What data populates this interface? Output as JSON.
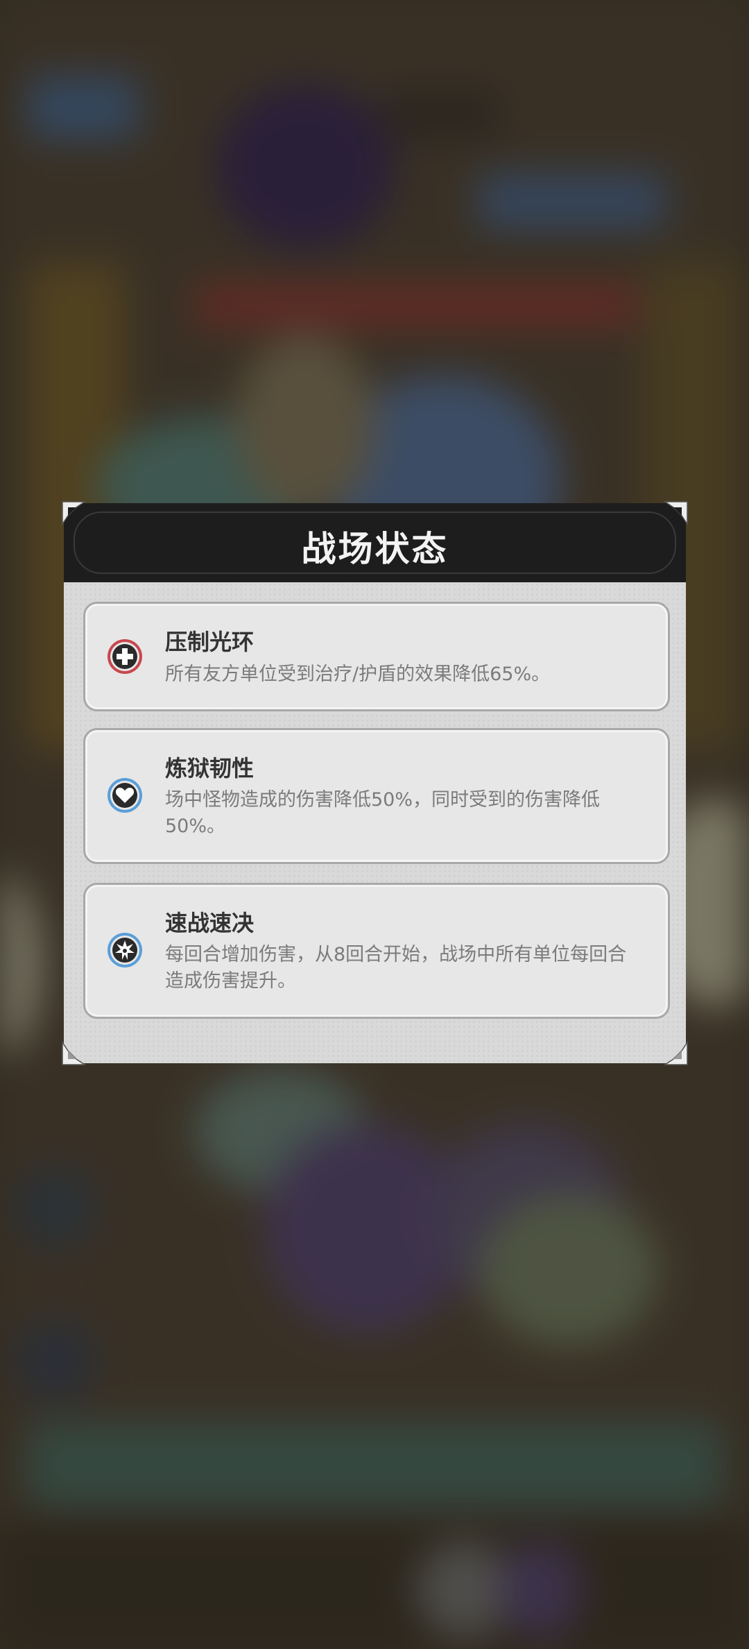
{
  "modal": {
    "title": "战场状态",
    "effects": [
      {
        "name": "压制光环",
        "description": "所有友方单位受到治疗/护盾的效果降低65%。",
        "icon": "plus-cross-icon",
        "icon_color": "#c8474e"
      },
      {
        "name": "炼狱韧性",
        "description": "场中怪物造成的伤害降低50%，同时受到的伤害降低50%。",
        "icon": "heart-icon",
        "icon_color": "#5a9ed8"
      },
      {
        "name": "速战速决",
        "description": "每回合增加伤害，从8回合开始，战场中所有单位每回合造成伤害提升。",
        "icon": "burst-icon",
        "icon_color": "#5a9ed8"
      }
    ]
  },
  "colors": {
    "header_bg": "#1d1d1d",
    "body_bg": "#d9d9d9",
    "card_bg": "#e7e7e7",
    "title_text": "#333333",
    "desc_text": "#7b7b7b"
  }
}
